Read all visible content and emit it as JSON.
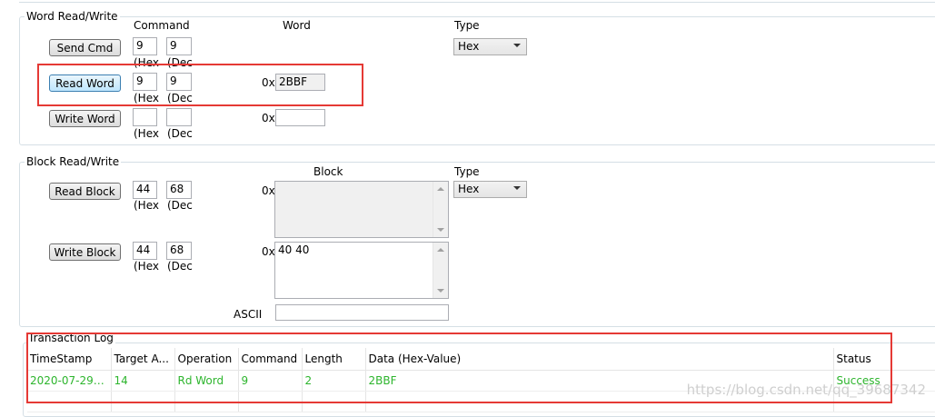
{
  "word_rw": {
    "legend": "Word Read/Write",
    "col_command": "Command",
    "col_word": "Word",
    "col_type": "Type",
    "hex_label": "(Hex",
    "dec_label": "(Dec",
    "prefix_0x": "0x",
    "type_value": "Hex",
    "send_cmd": {
      "label": "Send Cmd",
      "hex": "9",
      "dec": "9"
    },
    "read_word": {
      "label": "Read Word",
      "hex": "9",
      "dec": "9",
      "value": "2BBF"
    },
    "write_word": {
      "label": "Write Word",
      "hex": "",
      "dec": "",
      "value": ""
    }
  },
  "block_rw": {
    "legend": "Block Read/Write",
    "col_block": "Block",
    "col_type": "Type",
    "hex_label": "(Hex",
    "dec_label": "(Dec",
    "prefix_0x": "0x",
    "type_value": "Hex",
    "read_block": {
      "label": "Read Block",
      "hex": "44",
      "dec": "68",
      "value": ""
    },
    "write_block": {
      "label": "Write Block",
      "hex": "44",
      "dec": "68",
      "value": "40 40"
    },
    "ascii_label": "ASCII",
    "ascii_value": ""
  },
  "log": {
    "legend": "Transaction Log",
    "columns": [
      "TimeStamp",
      "Target A...",
      "Operation",
      "Command",
      "Length",
      "Data (Hex-Value)",
      "Status"
    ],
    "rows": [
      [
        "2020-07-29 0...",
        "14",
        "Rd Word",
        "9",
        "2",
        "2BBF",
        "Success"
      ]
    ],
    "row_color": "#2db52d"
  },
  "watermark": "https://blog.csdn.net/qq_39687342"
}
